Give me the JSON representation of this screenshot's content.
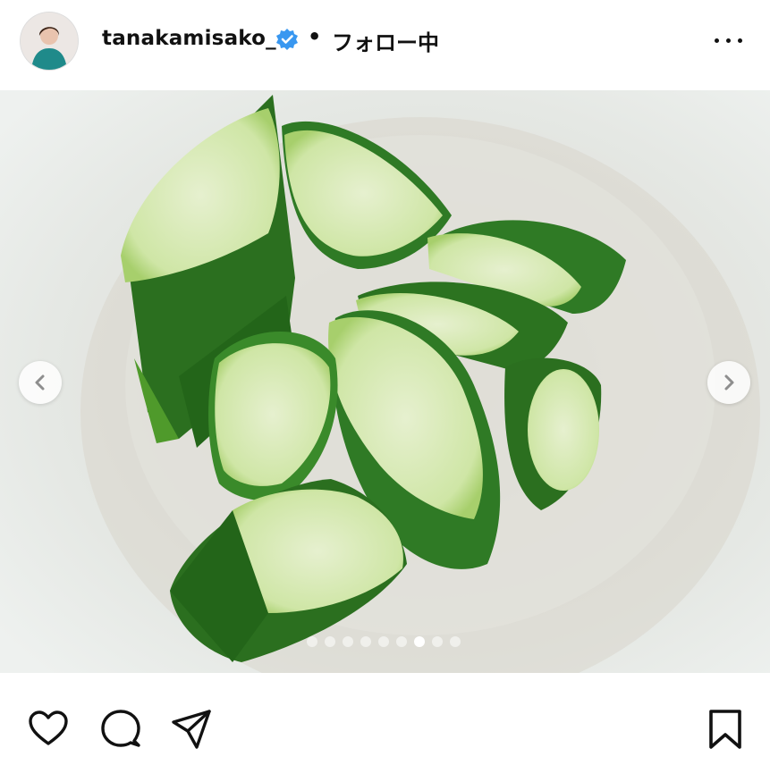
{
  "header": {
    "username": "tanakamisako_",
    "separator": "•",
    "follow_status": "フォロー中",
    "avatar_icon": "profile-photo",
    "verified_icon": "verified-badge-icon",
    "more_icon": "more-options-icon"
  },
  "media": {
    "image_icon": "cucumber-photo",
    "total_slides": 9,
    "active_slide": 7,
    "prev_icon": "chevron-left-icon",
    "next_icon": "chevron-right-icon"
  },
  "actions": {
    "like_icon": "heart-icon",
    "comment_icon": "comment-icon",
    "share_icon": "send-icon",
    "save_icon": "bookmark-icon"
  },
  "colors": {
    "verified_blue": "#3897f0",
    "text": "#111111",
    "plate": "#e8ecea",
    "cucumber_skin": "#2f7a25",
    "cucumber_flesh": "#d8ebbb"
  }
}
